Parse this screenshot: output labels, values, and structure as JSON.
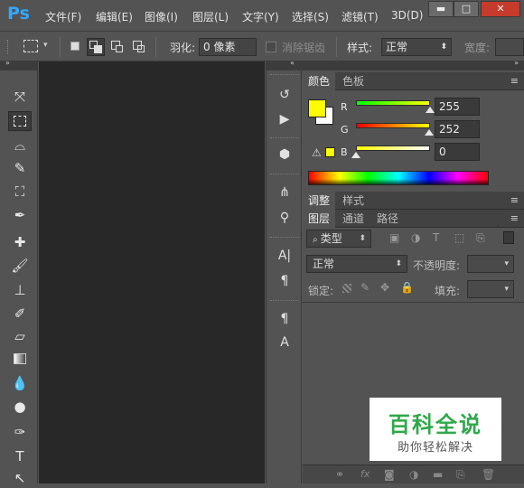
{
  "app": {
    "logo": "Ps"
  },
  "menu": [
    "文件(F)",
    "编辑(E)",
    "图像(I)",
    "图层(L)",
    "文字(Y)",
    "选择(S)",
    "滤镜(T)",
    "3D(D)"
  ],
  "window_controls": {
    "minimize": "▬",
    "maximize": "□",
    "close": "✕"
  },
  "options": {
    "feather_label": "羽化:",
    "feather_value": "0 像素",
    "antialias_label": "消除锯齿",
    "style_label": "样式:",
    "style_value": "正常",
    "width_label": "宽度:"
  },
  "color_panel": {
    "tabs": [
      "颜色",
      "色板"
    ],
    "channels": [
      {
        "label": "R",
        "value": "255",
        "color": "#00c800",
        "fill": 1.0
      },
      {
        "label": "G",
        "value": "252",
        "color": "#ff3c3c",
        "fill": 0.988
      },
      {
        "label": "B",
        "value": "0",
        "color": "#f0f000",
        "fill": 0.0
      }
    ],
    "foreground": "#fffc00",
    "background": "#ffffff"
  },
  "adjust_panel": {
    "tabs": [
      "调整",
      "样式"
    ]
  },
  "layers_panel": {
    "tabs": [
      "图层",
      "通道",
      "路径"
    ],
    "filter_label": "类型",
    "blend_mode": "正常",
    "opacity_label": "不透明度:",
    "lock_label": "锁定:",
    "fill_label": "填充:"
  },
  "watermark": {
    "title": "百科全说",
    "subtitle": "助你轻松解决"
  }
}
